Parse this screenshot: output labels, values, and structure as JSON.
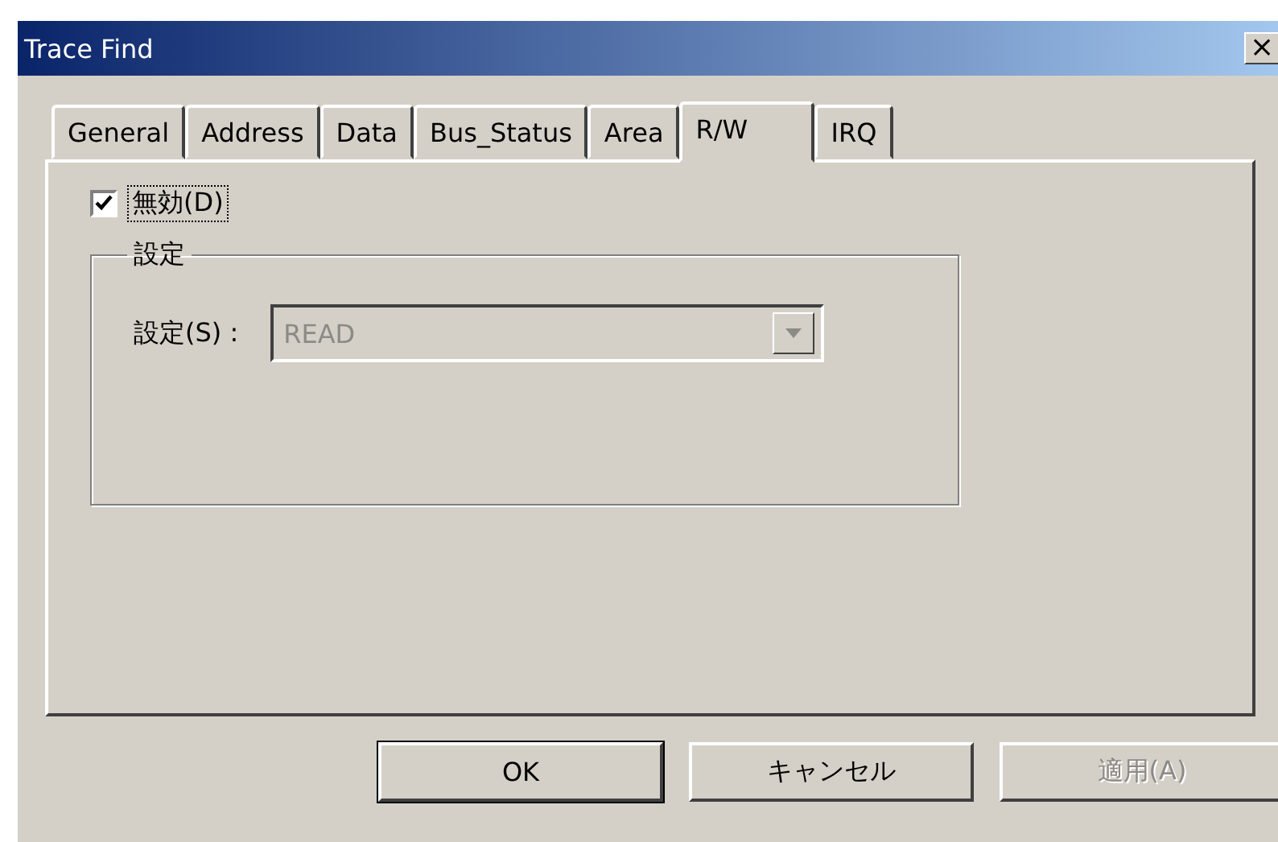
{
  "window": {
    "title": "Trace Find",
    "close": "×"
  },
  "tabs": [
    {
      "label": "General",
      "selected": false
    },
    {
      "label": "Address",
      "selected": false
    },
    {
      "label": "Data",
      "selected": false
    },
    {
      "label": "Bus_Status",
      "selected": false
    },
    {
      "label": "Area",
      "selected": false
    },
    {
      "label": "R/W",
      "selected": true
    },
    {
      "label": "IRQ",
      "selected": false
    }
  ],
  "disable_checkbox": {
    "label": "無効(D)",
    "checked": true,
    "focused": true
  },
  "group": {
    "title": "設定",
    "setting_label": "設定(S) :",
    "setting_value": "READ",
    "disabled": true
  },
  "buttons": [
    {
      "label": "OK",
      "default": true,
      "disabled": false
    },
    {
      "label": "キャンセル",
      "default": false,
      "disabled": false
    },
    {
      "label": "適用(A)",
      "default": false,
      "disabled": true
    }
  ]
}
